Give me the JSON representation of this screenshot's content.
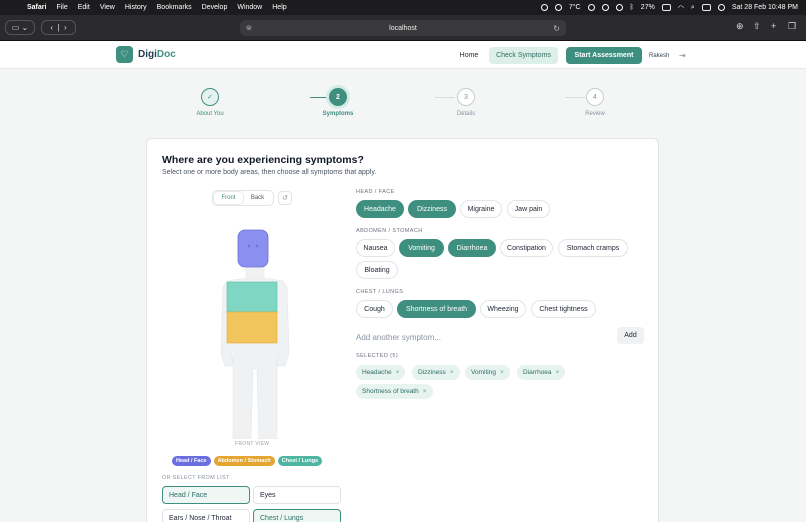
{
  "menubar": {
    "app": "Safari",
    "items": [
      "File",
      "Edit",
      "View",
      "History",
      "Bookmarks",
      "Develop",
      "Window",
      "Help"
    ],
    "weather": "7°C",
    "battery": "27%",
    "datetime": "Sat 28 Feb  10:48 PM"
  },
  "browser": {
    "url": "localhost"
  },
  "nav": {
    "logo_a": "Digi",
    "logo_b": "Doc",
    "home": "Home",
    "check": "Check Symptoms",
    "start": "Start Assessment",
    "user": "Rakesh"
  },
  "steps": [
    {
      "num": "✓",
      "label": "About You",
      "state": "done"
    },
    {
      "num": "2",
      "label": "Symptoms",
      "state": "active"
    },
    {
      "num": "3",
      "label": "Details",
      "state": "todo"
    },
    {
      "num": "4",
      "label": "Review",
      "state": "todo"
    }
  ],
  "card": {
    "title": "Where are you experiencing symptoms?",
    "subtitle": "Select one or more body areas, then choose all symptoms that apply.",
    "front": "Front",
    "back": "Back",
    "front_view": "FRONT VIEW",
    "legend": [
      "Head / Face",
      "Abdomen / Stomach",
      "Chest / Lungs"
    ],
    "or_select": "OR SELECT FROM LIST",
    "areas": [
      "Head / Face",
      "Eyes",
      "Ears / Nose / Throat",
      "Chest / Lungs"
    ]
  },
  "groups": {
    "head": {
      "label": "HEAD / FACE",
      "chips": [
        "Headache",
        "Dizziness",
        "Migraine",
        "Jaw pain"
      ]
    },
    "abdomen": {
      "label": "ABDOMEN / STOMACH",
      "chips": [
        "Nausea",
        "Vomiting",
        "Diarrhoea",
        "Constipation",
        "Stomach cramps",
        "Bloating"
      ]
    },
    "chest": {
      "label": "CHEST / LUNGS",
      "chips": [
        "Cough",
        "Shortness of breath",
        "Wheezing",
        "Chest tightness"
      ]
    }
  },
  "add": {
    "placeholder": "Add another symptom...",
    "button": "Add"
  },
  "selected": {
    "label": "SELECTED (5)",
    "tags": [
      "Headache",
      "Dizziness",
      "Vomiting",
      "Diarrhoea",
      "Shortness of breath"
    ]
  },
  "colors": {
    "accent": "#3f8f80",
    "head": "#8b8ff0",
    "chest": "#7fd6c3",
    "abdomen": "#f2c45c"
  }
}
